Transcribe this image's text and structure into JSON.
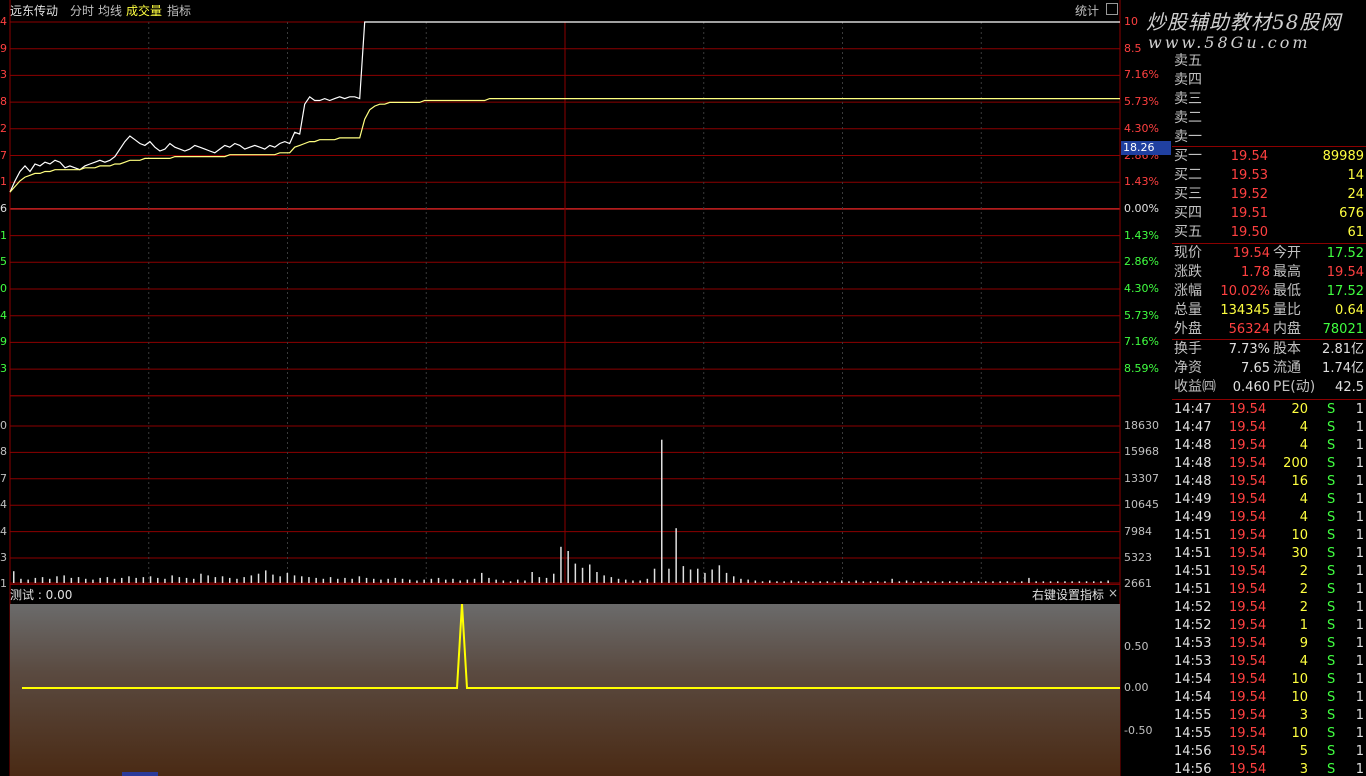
{
  "header": {
    "stock_name": "远东传动",
    "tabs": [
      {
        "label": "分时",
        "color": "#e0e0e0"
      },
      {
        "label": "均线",
        "color": "#e0e0e0"
      },
      {
        "label": "成交量",
        "color": "#ffff40"
      },
      {
        "label": "指标",
        "color": "#e0e0e0"
      }
    ],
    "stats_label": "统计"
  },
  "watermark": {
    "line1": "炒股辅助教材58股网",
    "line2": "www.58Gu.com"
  },
  "price_axis": {
    "right_labels": [
      "10",
      "8.5",
      "7.16%",
      "5.73%",
      "4.30%",
      "2.86%",
      "1.43%",
      "0.00%",
      "1.43%",
      "2.86%",
      "4.30%",
      "5.73%",
      "7.16%",
      "8.59%"
    ],
    "right_colors": [
      "#ff4040",
      "#ff4040",
      "#ff4040",
      "#ff4040",
      "#ff4040",
      "#ff4040",
      "#ff4040",
      "#e0e0e0",
      "#40ff40",
      "#40ff40",
      "#40ff40",
      "#40ff40",
      "#40ff40",
      "#40ff40"
    ],
    "left_labels": [
      "4",
      "9",
      "3",
      "8",
      "2",
      "7",
      "1",
      "6",
      "1",
      "5",
      "0",
      "4",
      "9",
      "3"
    ],
    "left_colors": [
      "#ff4040",
      "#ff4040",
      "#ff4040",
      "#ff4040",
      "#ff4040",
      "#ff4040",
      "#ff4040",
      "#e0e0e0",
      "#40ff40",
      "#40ff40",
      "#40ff40",
      "#40ff40",
      "#40ff40",
      "#40ff40"
    ],
    "cursor_price": "18.26"
  },
  "volume_axis": {
    "right_labels": [
      "18630",
      "15968",
      "13307",
      "10645",
      "7984",
      "5323",
      "2661"
    ],
    "left_labels": [
      "0",
      "8",
      "7",
      "4",
      "4",
      "3",
      "1"
    ]
  },
  "indicator": {
    "title": "测试 : 0.00",
    "hint": "右键设置指标",
    "close": "×",
    "axis_labels": [
      "0.50",
      "0.00",
      "-0.50"
    ]
  },
  "order_book": {
    "sells": [
      {
        "label": "卖五",
        "price": "",
        "vol": ""
      },
      {
        "label": "卖四",
        "price": "",
        "vol": ""
      },
      {
        "label": "卖三",
        "price": "",
        "vol": ""
      },
      {
        "label": "卖二",
        "price": "",
        "vol": ""
      },
      {
        "label": "卖一",
        "price": "",
        "vol": ""
      }
    ],
    "buys": [
      {
        "label": "买一",
        "price": "19.54",
        "vol": "89989"
      },
      {
        "label": "买二",
        "price": "19.53",
        "vol": "14"
      },
      {
        "label": "买三",
        "price": "19.52",
        "vol": "24"
      },
      {
        "label": "买四",
        "price": "19.51",
        "vol": "676"
      },
      {
        "label": "买五",
        "price": "19.50",
        "vol": "61"
      }
    ]
  },
  "quote": [
    {
      "l1": "现价",
      "v1": "19.54",
      "c1": "red",
      "l2": "今开",
      "v2": "17.52",
      "c2": "green"
    },
    {
      "l1": "涨跌",
      "v1": "1.78",
      "c1": "red",
      "l2": "最高",
      "v2": "19.54",
      "c2": "red"
    },
    {
      "l1": "涨幅",
      "v1": "10.02%",
      "c1": "red",
      "l2": "最低",
      "v2": "17.52",
      "c2": "green"
    },
    {
      "l1": "总量",
      "v1": "134345",
      "c1": "yellow",
      "l2": "量比",
      "v2": "0.64",
      "c2": "yellow"
    },
    {
      "l1": "外盘",
      "v1": "56324",
      "c1": "red",
      "l2": "内盘",
      "v2": "78021",
      "c2": "green"
    }
  ],
  "fundamentals": [
    {
      "l1": "换手",
      "v1": "7.73%",
      "l2": "股本",
      "v2": "2.81亿"
    },
    {
      "l1": "净资",
      "v1": "7.65",
      "l2": "流通",
      "v2": "1.74亿"
    },
    {
      "l1": "收益㈣",
      "v1": "0.460",
      "l2": "PE(动)",
      "v2": "42.5"
    }
  ],
  "ticks": [
    {
      "time": "14:47",
      "price": "19.54",
      "vol": "20",
      "side": "S",
      "n": "1"
    },
    {
      "time": "14:47",
      "price": "19.54",
      "vol": "4",
      "side": "S",
      "n": "1"
    },
    {
      "time": "14:48",
      "price": "19.54",
      "vol": "4",
      "side": "S",
      "n": "1"
    },
    {
      "time": "14:48",
      "price": "19.54",
      "vol": "200",
      "side": "S",
      "n": "1"
    },
    {
      "time": "14:48",
      "price": "19.54",
      "vol": "16",
      "side": "S",
      "n": "1"
    },
    {
      "time": "14:49",
      "price": "19.54",
      "vol": "4",
      "side": "S",
      "n": "1"
    },
    {
      "time": "14:49",
      "price": "19.54",
      "vol": "4",
      "side": "S",
      "n": "1"
    },
    {
      "time": "14:51",
      "price": "19.54",
      "vol": "10",
      "side": "S",
      "n": "1"
    },
    {
      "time": "14:51",
      "price": "19.54",
      "vol": "30",
      "side": "S",
      "n": "1"
    },
    {
      "time": "14:51",
      "price": "19.54",
      "vol": "2",
      "side": "S",
      "n": "1"
    },
    {
      "time": "14:51",
      "price": "19.54",
      "vol": "2",
      "side": "S",
      "n": "1"
    },
    {
      "time": "14:52",
      "price": "19.54",
      "vol": "2",
      "side": "S",
      "n": "1"
    },
    {
      "time": "14:52",
      "price": "19.54",
      "vol": "1",
      "side": "S",
      "n": "1"
    },
    {
      "time": "14:53",
      "price": "19.54",
      "vol": "9",
      "side": "S",
      "n": "1"
    },
    {
      "time": "14:53",
      "price": "19.54",
      "vol": "4",
      "side": "S",
      "n": "1"
    },
    {
      "time": "14:54",
      "price": "19.54",
      "vol": "10",
      "side": "S",
      "n": "1"
    },
    {
      "time": "14:54",
      "price": "19.54",
      "vol": "10",
      "side": "S",
      "n": "1"
    },
    {
      "time": "14:55",
      "price": "19.54",
      "vol": "3",
      "side": "S",
      "n": "1"
    },
    {
      "time": "14:55",
      "price": "19.54",
      "vol": "10",
      "side": "S",
      "n": "1"
    },
    {
      "time": "14:56",
      "price": "19.54",
      "vol": "5",
      "side": "S",
      "n": "1"
    },
    {
      "time": "14:56",
      "price": "19.54",
      "vol": "3",
      "side": "S",
      "n": "1"
    }
  ],
  "price_series": [
    0.9,
    1.5,
    2.0,
    2.3,
    2.0,
    2.4,
    2.3,
    2.5,
    2.4,
    2.6,
    2.5,
    2.2,
    2.3,
    2.2,
    2.1,
    2.3,
    2.4,
    2.5,
    2.6,
    2.5,
    2.6,
    2.8,
    3.2,
    3.6,
    3.9,
    3.7,
    3.5,
    3.4,
    3.6,
    3.3,
    3.1,
    3.2,
    3.5,
    3.3,
    3.2,
    3.1,
    3.2,
    3.4,
    3.3,
    3.2,
    3.1,
    3.0,
    3.2,
    3.4,
    3.3,
    3.5,
    3.4,
    3.2,
    3.3,
    3.4,
    3.3,
    3.2,
    3.4,
    3.3,
    3.5,
    3.6,
    3.5,
    4.1,
    4.0,
    5.6,
    6.0,
    5.8,
    5.8,
    5.9,
    5.8,
    5.9,
    6.0,
    5.9,
    6.0,
    6.0,
    5.9,
    10.0,
    10.0,
    10.0,
    10.0,
    10.0,
    10.0,
    10.0,
    10.0,
    10.0,
    10.0,
    10.0,
    10.0,
    10.0,
    10.0,
    10.0,
    10.0,
    10.0,
    10.0,
    10.0,
    10.0,
    10.0,
    10.0,
    10.0,
    10.0,
    10.0,
    10.0,
    10.0,
    10.0,
    10.0,
    10.0
  ],
  "avg_series": [
    0.9,
    1.2,
    1.5,
    1.7,
    1.8,
    1.9,
    1.9,
    2.0,
    2.0,
    2.1,
    2.1,
    2.1,
    2.1,
    2.1,
    2.1,
    2.2,
    2.2,
    2.2,
    2.3,
    2.3,
    2.3,
    2.4,
    2.4,
    2.5,
    2.6,
    2.6,
    2.6,
    2.7,
    2.7,
    2.7,
    2.7,
    2.7,
    2.7,
    2.8,
    2.8,
    2.8,
    2.8,
    2.8,
    2.8,
    2.8,
    2.8,
    2.8,
    2.8,
    2.8,
    2.9,
    2.9,
    2.9,
    2.9,
    2.9,
    2.9,
    2.9,
    2.9,
    2.9,
    2.9,
    3.0,
    3.0,
    3.0,
    3.3,
    3.4,
    3.5,
    3.6,
    3.6,
    3.7,
    3.7,
    3.7,
    3.7,
    3.8,
    3.8,
    3.8,
    3.8,
    3.8,
    4.8,
    5.3,
    5.5,
    5.6,
    5.6,
    5.7,
    5.7,
    5.7,
    5.7,
    5.7,
    5.7,
    5.7,
    5.8,
    5.8,
    5.8,
    5.8,
    5.8,
    5.8,
    5.8,
    5.8,
    5.8,
    5.8,
    5.8,
    5.8,
    5.8,
    5.9,
    5.9,
    5.9,
    5.9,
    5.9
  ],
  "volume_series": [
    1400,
    500,
    400,
    600,
    700,
    500,
    800,
    900,
    600,
    700,
    500,
    400,
    600,
    700,
    500,
    600,
    800,
    600,
    700,
    800,
    600,
    500,
    900,
    700,
    600,
    500,
    1100,
    900,
    700,
    800,
    600,
    500,
    700,
    900,
    1100,
    1500,
    1000,
    800,
    1200,
    900,
    800,
    700,
    600,
    500,
    700,
    500,
    600,
    500,
    800,
    600,
    500,
    400,
    500,
    600,
    500,
    400,
    300,
    400,
    500,
    600,
    400,
    500,
    300,
    400,
    500,
    1200,
    600,
    400,
    300,
    200,
    400,
    300,
    1300,
    700,
    600,
    1100,
    4300,
    3800,
    2300,
    1800,
    2200,
    1300,
    900,
    700,
    500,
    400,
    300,
    300,
    500,
    1700,
    17000,
    1700,
    6500,
    2000,
    1600,
    1700,
    1200,
    1600,
    2100,
    1200,
    800,
    500,
    400,
    300,
    200,
    300,
    200,
    200,
    300,
    200,
    200,
    200,
    200,
    200,
    200,
    300,
    200,
    300,
    200,
    200,
    200,
    200,
    500,
    200,
    300,
    200,
    200,
    200,
    200,
    200,
    200,
    200,
    200,
    200,
    200,
    200,
    200,
    200,
    200,
    200,
    200,
    600,
    200,
    200,
    200,
    200,
    200,
    200,
    200,
    200,
    200,
    200,
    300
  ]
}
